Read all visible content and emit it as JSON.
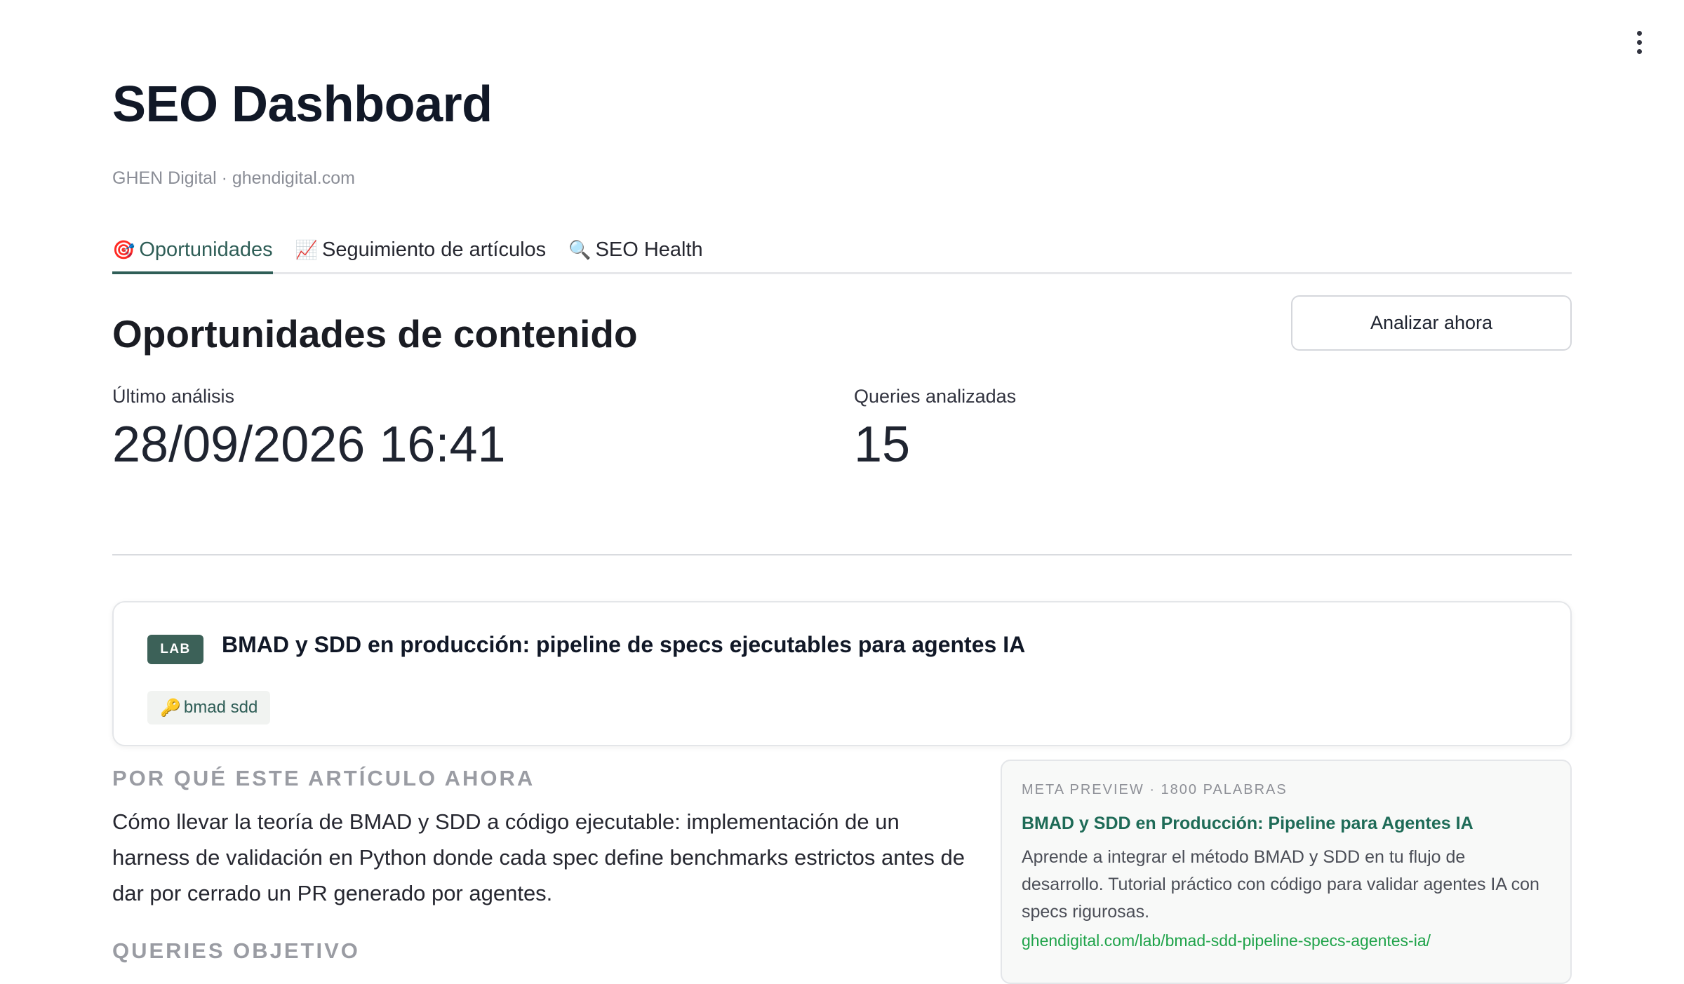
{
  "header": {
    "title": "SEO Dashboard",
    "caption": "GHEN Digital · ghendigital.com"
  },
  "menu": {
    "icon": "vertical-dots-icon"
  },
  "tabs": [
    {
      "icon": "🎯",
      "label": "Oportunidades",
      "active": true
    },
    {
      "icon": "📈",
      "label": "Seguimiento de artículos",
      "active": false
    },
    {
      "icon": "🔍",
      "label": "SEO Health",
      "active": false
    }
  ],
  "opportunities": {
    "title": "Oportunidades de contenido",
    "analyze_label": "Analizar ahora",
    "metrics": {
      "last_analysis": {
        "label": "Último análisis",
        "value": "28/09/2026 16:41"
      },
      "queries": {
        "label": "Queries analizadas",
        "value": "15"
      }
    }
  },
  "article": {
    "badge": "LAB",
    "title": "BMAD y SDD en producción: pipeline de specs ejecutables para agentes IA",
    "keyword_icon": "🔑",
    "keyword": "bmad sdd",
    "why_heading": "POR QUÉ ESTE ARTÍCULO AHORA",
    "why_text": "Cómo llevar la teoría de BMAD y SDD a código ejecutable: implementación de un harness de validación en Python donde cada spec define benchmarks estrictos antes de dar por cerrado un PR generado por agentes.",
    "queries_heading": "QUERIES OBJETIVO",
    "meta": {
      "label": "META PREVIEW · 1800 PALABRAS",
      "title": "BMAD y SDD en Producción: Pipeline para Agentes IA",
      "description": "Aprende a integrar el método BMAD y SDD en tu flujo de desarrollo. Tutorial práctico con código para validar agentes IA con specs rigurosas.",
      "url": "ghendigital.com/lab/bmad-sdd-pipeline-specs-agentes-ia/"
    }
  },
  "colors": {
    "accent": "#2f5e57",
    "badge_bg": "#3c6158",
    "meta_title": "#1e6b57",
    "meta_url": "#1fa34a"
  }
}
